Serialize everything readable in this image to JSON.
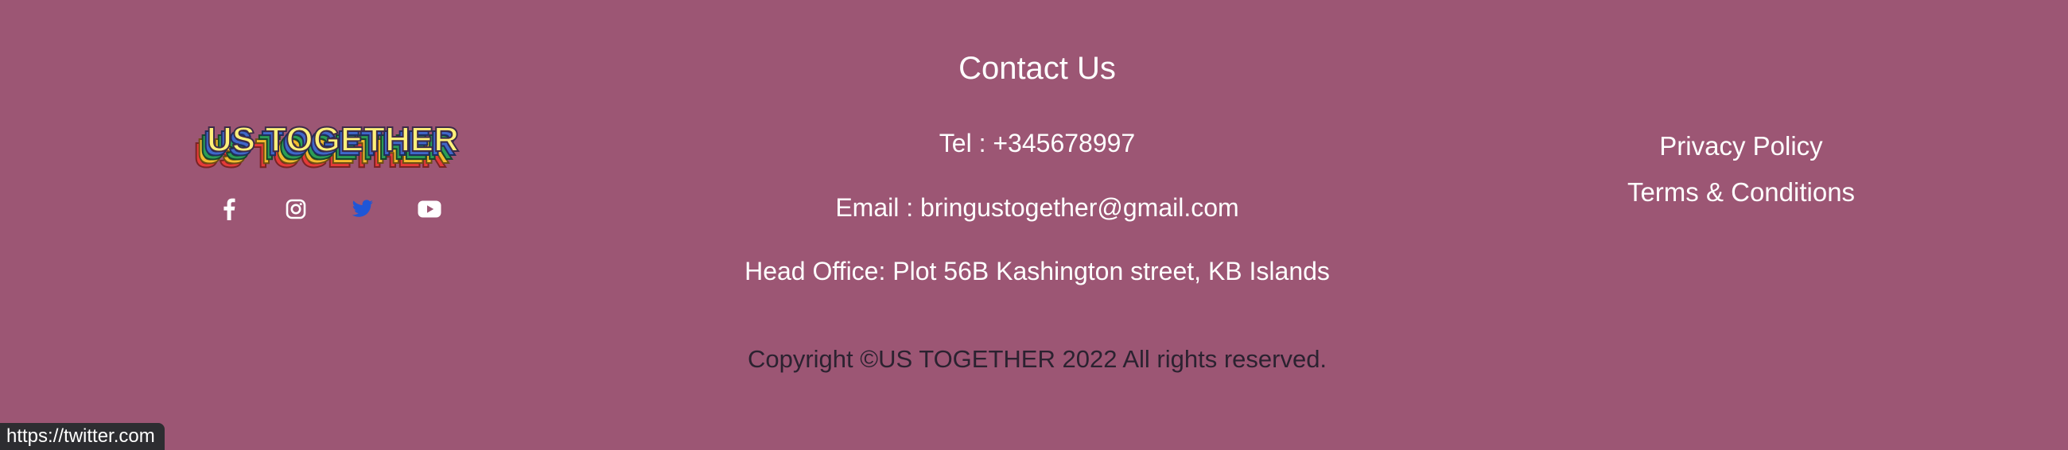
{
  "brand": {
    "logo_text": "US TOGETHER"
  },
  "contact": {
    "title": "Contact Us",
    "tel": "Tel : +345678997",
    "email": "Email : bringustogether@gmail.com",
    "office": "Head Office: Plot 56B Kashington street, KB Islands"
  },
  "social": {
    "facebook_icon": "facebook-icon",
    "instagram_icon": "instagram-icon",
    "twitter_icon": "twitter-icon",
    "youtube_icon": "youtube-icon"
  },
  "links": {
    "privacy": "Privacy Policy",
    "terms": "Terms & Conditions"
  },
  "footer": {
    "copyright": "Copyright ©US TOGETHER 2022 All rights reserved."
  },
  "status_bar": {
    "url": "https://twitter.com"
  },
  "colors": {
    "background": "#9c5674",
    "text": "#ffffff",
    "copyright_text": "#2b2230",
    "twitter_hover": "#1f56d6",
    "status_bg": "#2d2d31"
  }
}
